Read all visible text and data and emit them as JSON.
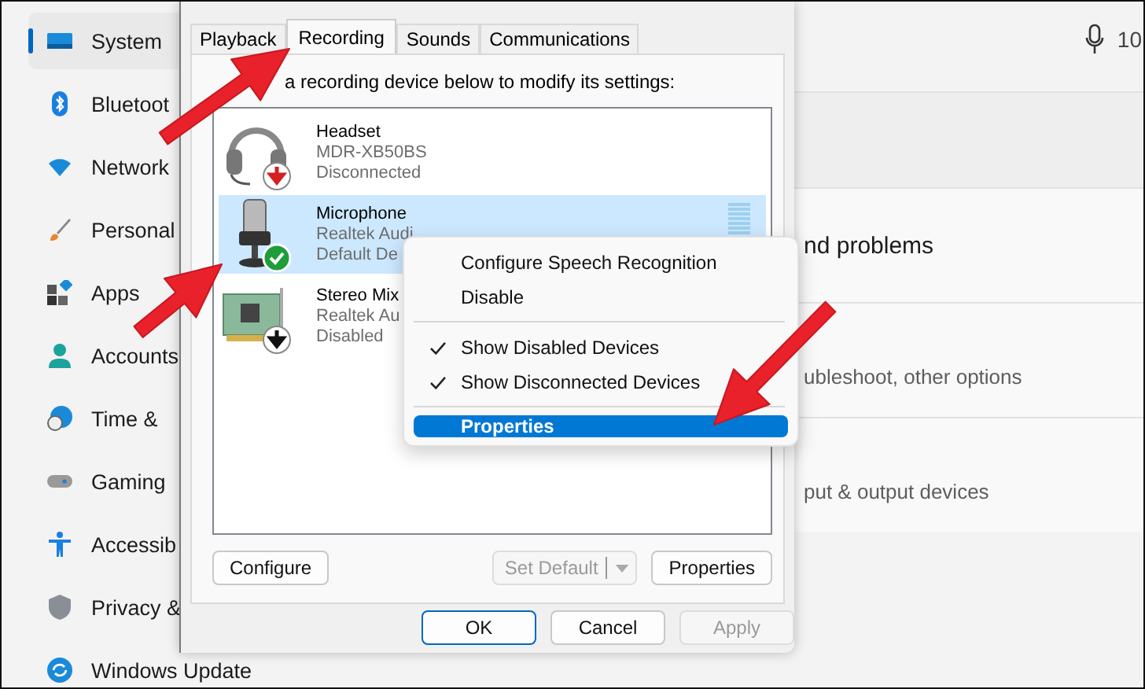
{
  "sidebar": {
    "items": [
      {
        "label": "System",
        "kind": "system",
        "selected": true
      },
      {
        "label": "Bluetoot",
        "kind": "bluetooth",
        "selected": false
      },
      {
        "label": "Network",
        "kind": "network",
        "selected": false
      },
      {
        "label": "Personal",
        "kind": "brush",
        "selected": false
      },
      {
        "label": "Apps",
        "kind": "apps",
        "selected": false
      },
      {
        "label": "Accounts",
        "kind": "person",
        "selected": false
      },
      {
        "label": "Time &",
        "kind": "clock",
        "selected": false
      },
      {
        "label": "Gaming",
        "kind": "gamepad",
        "selected": false
      },
      {
        "label": "Accessib",
        "kind": "accessibility",
        "selected": false
      },
      {
        "label": "Privacy &",
        "kind": "shield",
        "selected": false
      },
      {
        "label": "Windows Update",
        "kind": "update",
        "selected": false
      }
    ]
  },
  "dialog": {
    "tabs": [
      {
        "label": "Playback",
        "selected": false
      },
      {
        "label": "Recording",
        "selected": true
      },
      {
        "label": "Sounds",
        "selected": false
      },
      {
        "label": "Communications",
        "selected": false
      }
    ],
    "instruction": "a recording device below to modify its settings:",
    "devices": [
      {
        "name": "Headset",
        "driver": "MDR-XB50BS",
        "status": "Disconnected",
        "kind": "headset",
        "badge": {
          "kind": "disconnected"
        },
        "selected": false
      },
      {
        "name": "Microphone",
        "driver": "Realtek Audi",
        "status": "Default De",
        "kind": "microphone",
        "badge": {
          "kind": "default"
        },
        "selected": true
      },
      {
        "name": "Stereo Mix",
        "driver": "Realtek Au",
        "status": "Disabled",
        "kind": "board",
        "badge": {
          "kind": "disabled"
        },
        "selected": false
      }
    ],
    "buttons": [
      {
        "label": "Configure",
        "disabled": false
      },
      {
        "label": "Set Default",
        "disabled": true,
        "kind": "split"
      },
      {
        "label": "Properties",
        "disabled": false
      }
    ],
    "footer_buttons": [
      {
        "label": "OK",
        "disabled": false,
        "default": true
      },
      {
        "label": "Cancel",
        "disabled": false,
        "default": false
      },
      {
        "label": "Apply",
        "disabled": true,
        "default": false
      }
    ]
  },
  "context_menu": {
    "items": [
      {
        "label": "Configure Speech Recognition",
        "kind": "item",
        "checked": false,
        "selected": false
      },
      {
        "label": "Disable",
        "kind": "item",
        "checked": false,
        "selected": false
      },
      {
        "kind": "separator"
      },
      {
        "label": "Show Disabled Devices",
        "kind": "item",
        "checked": true,
        "selected": false
      },
      {
        "label": "Show Disconnected Devices",
        "kind": "item",
        "checked": true,
        "selected": false
      },
      {
        "kind": "separator"
      },
      {
        "label": "Properties",
        "kind": "item",
        "checked": false,
        "selected": true
      }
    ]
  },
  "settings": {
    "header_text": "10",
    "rows": [
      {
        "text": "nd problems",
        "kind": "title"
      },
      {
        "text": "ubleshoot, other options",
        "kind": "subtitle"
      },
      {
        "text": "put & output devices",
        "kind": "subtitle"
      }
    ]
  }
}
